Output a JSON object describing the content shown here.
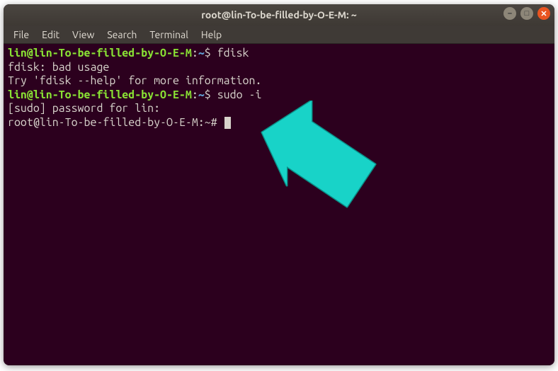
{
  "window": {
    "title": "root@lin-To-be-filled-by-O-E-M: ~"
  },
  "menu": {
    "file": "File",
    "edit": "Edit",
    "view": "View",
    "search": "Search",
    "terminal": "Terminal",
    "help": "Help"
  },
  "lines": {
    "l1_prompt": "lin@lin-To-be-filled-by-O-E-M",
    "l1_colon": ":",
    "l1_tilde": "~",
    "l1_dollar": "$ ",
    "l1_cmd": "fdisk",
    "l2": "fdisk: bad usage",
    "l3": "Try 'fdisk --help' for more information.",
    "l4_prompt": "lin@lin-To-be-filled-by-O-E-M",
    "l4_colon": ":",
    "l4_tilde": "~",
    "l4_dollar": "$ ",
    "l4_cmd": "sudo -i",
    "l5": "[sudo] password for lin:",
    "l6_prompt": "root@lin-To-be-filled-by-O-E-M:~# "
  },
  "controls": {
    "min": "–",
    "max": "□",
    "close": "✕"
  },
  "arrow_color": "#18d3c8"
}
